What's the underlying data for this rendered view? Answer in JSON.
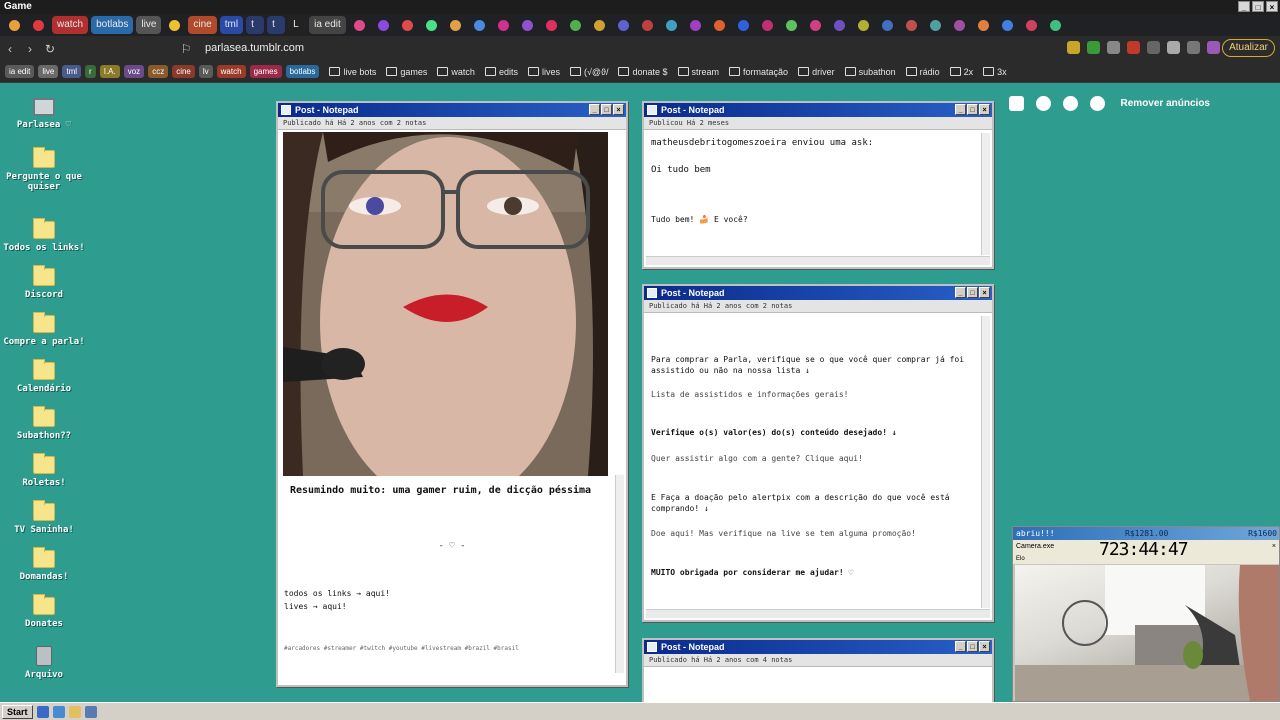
{
  "window_title": "Game",
  "tabs": [
    {
      "label": "",
      "color": "#e8a13a"
    },
    {
      "label": "",
      "color": "#e03a3a"
    },
    {
      "label": "watch",
      "color": "#b03030"
    },
    {
      "label": "botlabs",
      "color": "#2a6aa8"
    },
    {
      "label": "live",
      "color": "#555555"
    },
    {
      "label": "",
      "color": "#f0c030"
    },
    {
      "label": "cine",
      "color": "#b04a2a"
    },
    {
      "label": "tml",
      "color": "#2a4aa8"
    },
    {
      "label": "t",
      "color": "#2a3a6a"
    },
    {
      "label": "t",
      "color": "#2a3a6a"
    },
    {
      "label": "L",
      "color": "#222222"
    },
    {
      "label": "ia edit",
      "color": "#444444"
    }
  ],
  "address": {
    "url": "parlasea.tumblr.com",
    "update_label": "Atualizar"
  },
  "bookmark_chips": [
    {
      "label": "ia edit",
      "color": "#5a5a5a"
    },
    {
      "label": "live",
      "color": "#6a6a6a"
    },
    {
      "label": "tml",
      "color": "#4a5a8a"
    },
    {
      "label": "r",
      "color": "#3a6a3a"
    },
    {
      "label": "I.A.",
      "color": "#8a7a2a"
    },
    {
      "label": "voz",
      "color": "#6a4a8a"
    },
    {
      "label": "ccz",
      "color": "#8a5a2a"
    },
    {
      "label": "cine",
      "color": "#8a3a2a"
    },
    {
      "label": "lv",
      "color": "#5a5a5a"
    },
    {
      "label": "watch",
      "color": "#9a3a2a"
    },
    {
      "label": "games",
      "color": "#9a2a4a"
    },
    {
      "label": "botlabs",
      "color": "#2a6a9a"
    }
  ],
  "bookmark_folders": [
    "live bots",
    "games",
    "watch",
    "edits",
    "lives",
    "(√@ϑ/",
    "donate $",
    "stream",
    "formatação",
    "driver",
    "subathon",
    "rádio",
    "2x",
    "3x"
  ],
  "desktop_icons": [
    {
      "label": "Parlasea ♡",
      "kind": "pc"
    },
    {
      "label": "Pergunte o que quiser",
      "kind": "folder"
    },
    {
      "label": "Todos os links!",
      "kind": "folder"
    },
    {
      "label": "Discord",
      "kind": "folder"
    },
    {
      "label": "Compre a parla!",
      "kind": "folder"
    },
    {
      "label": "Calendário",
      "kind": "folder"
    },
    {
      "label": "Subathon??",
      "kind": "folder"
    },
    {
      "label": "Roletas!",
      "kind": "folder"
    },
    {
      "label": "TV Saninha!",
      "kind": "folder"
    },
    {
      "label": "Domandas!",
      "kind": "folder"
    },
    {
      "label": "Donates",
      "kind": "folder"
    },
    {
      "label": "Arquivo",
      "kind": "trash"
    }
  ],
  "post1": {
    "title": "Post - Notepad",
    "meta": "Publicado há Há 2 anos com 2 notas",
    "caption": "Resumindo muito: uma gamer ruim, de dicção péssima",
    "divider": "- ♡ -",
    "links": "todos os links → aqui!",
    "lives": "lives → aqui!",
    "tags": "#arcadores #streamer #twitch #youtube #livestream #brazil #brasil"
  },
  "post2": {
    "title": "Post - Notepad",
    "meta": "Publicou Há 2 meses",
    "ask": "matheusdebritogomeszoeira enviou uma ask:",
    "question": "Oi tudo bem",
    "answer": "Tudo bem! 🍰 E você?"
  },
  "post3": {
    "title": "Post - Notepad",
    "meta": "Publicado há Há 2 anos com 2 notas",
    "p1": "Para comprar a Parla, verifique se o que você quer comprar já foi assistido ou não na nossa lista ↓",
    "p2": "Lista de assistidos e informações gerais!",
    "p3": "Verifique o(s) valor(es) do(s) conteúdo desejado! ↓",
    "p4": "Quer assistir algo com a gente? Clique aqui!",
    "p5": "E Faça a doação pelo alertpix com a descrição do que você está comprando! ↓",
    "p6": "Doe aqui! Mas verifique na live se tem alguma promoção!",
    "p7": "MUITO obrigada por considerar me ajudar! ♡"
  },
  "post4": {
    "title": "Post - Notepad",
    "meta": "Publicado há Há 2 anos com 4 notas"
  },
  "blog_controls": {
    "remove_ads": "Remover anúncios"
  },
  "camera": {
    "status": "abriu!!!",
    "amount1": "R$1281.00",
    "amount2": "R$1600",
    "window": "Camera.exe",
    "sub": "Elo",
    "timer": "723:44:47"
  },
  "taskbar": {
    "start": "Start"
  }
}
